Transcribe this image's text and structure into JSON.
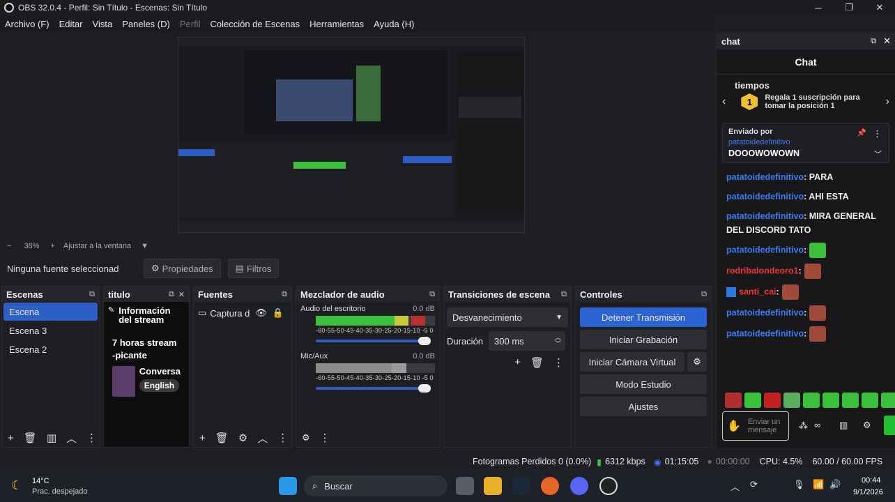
{
  "window": {
    "title": "OBS 32.0.4 - Perfil: Sin Título - Escenas: Sin Título"
  },
  "menu": [
    "Archivo (F)",
    "Editar",
    "Vista",
    "Paneles (D)",
    "Perfil",
    "Colección de Escenas",
    "Herramientas",
    "Ayuda (H)"
  ],
  "zoom": {
    "minus": "−",
    "value": "38%",
    "plus": "+",
    "fit": "Ajustar a la ventana"
  },
  "source_bar": {
    "none_selected": "Ninguna fuente seleccionad",
    "properties": "Propiedades",
    "filters": "Filtros"
  },
  "scenes": {
    "title": "Escenas",
    "items": [
      "Escena",
      "Escena 3",
      "Escena 2"
    ],
    "selected": 0
  },
  "titulo": {
    "title": "titulo",
    "info": "Información del stream",
    "stream_title": "7 horas stream -picante",
    "category": "Conversa",
    "lang": "English"
  },
  "sources": {
    "title": "Fuentes",
    "item": "Captura d"
  },
  "mixer": {
    "title": "Mezclador de audio",
    "channels": [
      {
        "name": "Audio del escritorio",
        "db": "0.0 dB",
        "level": 0.78
      },
      {
        "name": "Mic/Aux",
        "db": "0.0 dB",
        "level": 0.73
      }
    ],
    "scale": "-60-55-50-45-40-35-30-25-20-15-10 -5  0"
  },
  "transitions": {
    "title": "Transiciones de escena",
    "selected": "Desvanecimiento",
    "duration_label": "Duración",
    "duration_value": "300 ms"
  },
  "controls": {
    "title": "Controles",
    "stop_stream": "Detener Transmisión",
    "start_rec": "Iniciar Grabación",
    "virtual_cam": "Iniciar Cámara Virtual",
    "studio": "Modo Estudio",
    "settings": "Ajustes"
  },
  "chat": {
    "dock_title": "chat",
    "title": "Chat",
    "tiempos": "tiempos",
    "gift_num": "1",
    "gift_text": "Regala 1 suscripción para tomar la posición 1",
    "pinned_label": "Enviado por",
    "pinned_user": "patatoidedefinitivo",
    "pinned_msg": "DOOOWOWOWN",
    "messages": [
      {
        "user": "patatoidedefinitivo",
        "text": ": PARA"
      },
      {
        "user": "patatoidedefinitivo",
        "text": ": AHI ESTA"
      },
      {
        "user": "patatoidedefinitivo",
        "text": ": MIRA GENERAL DEL DISCORD TATO"
      },
      {
        "user": "patatoidedefinitivo",
        "text": ":"
      },
      {
        "user": "rodribalondeoro1",
        "text": ":"
      },
      {
        "user": "santi_cai",
        "text": ":"
      },
      {
        "user": "patatoidedefinitivo",
        "text": ":"
      },
      {
        "user": "patatoidedefinitivo",
        "text": ":"
      }
    ],
    "input_placeholder": "Enviar un mensaje"
  },
  "status": {
    "dropped": "Fotogramas Perdidos 0 (0.0%)",
    "kbps": "6312 kbps",
    "stream_time": "01:15:05",
    "rec_time": "00:00:00",
    "cpu": "CPU: 4.5%",
    "fps": "60.00 / 60.00 FPS"
  },
  "taskbar": {
    "temp": "14°C",
    "weather": "Prac. despejado",
    "search": "Buscar",
    "time": "00:44",
    "date": "9/1/2026"
  },
  "colors": {
    "accent": "#2d62d2",
    "chat_user": "#3c7cf0"
  }
}
